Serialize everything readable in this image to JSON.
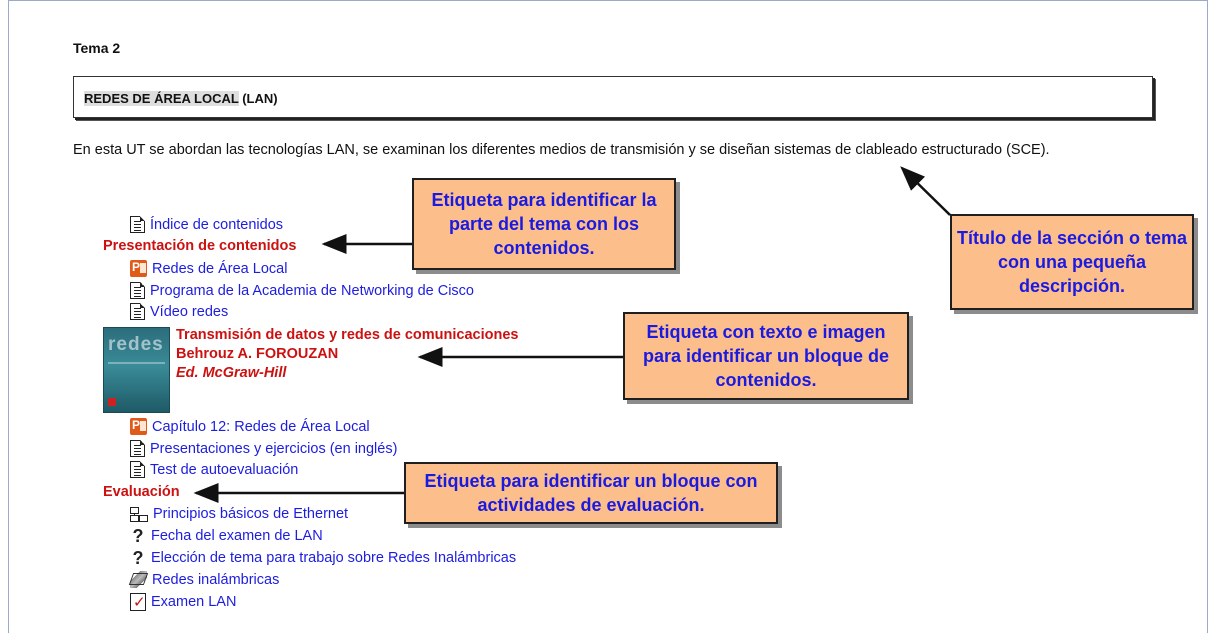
{
  "section": {
    "label": "Tema 2",
    "title_highlight": "REDES DE ÁREA LOCAL",
    "title_rest": " (LAN)",
    "description": "En esta UT se abordan las tecnologías LAN, se examinan los diferentes medios de transmisión y se diseñan sistemas de clableado estructurado (SCE)."
  },
  "resources": {
    "indice": "Índice de contenidos",
    "presentacion_heading": "Presentación de contenidos",
    "redes_area_local": "Redes de Área Local",
    "programa_cisco": "Programa de la Academia de Networking de Cisco",
    "video_redes": "Vídeo redes",
    "book": {
      "title": "Transmisión de datos y redes de comunicaciones",
      "author": "Behrouz A. FOROUZAN",
      "publisher": "Ed. McGraw-Hill",
      "cover_text": "redes"
    },
    "capitulo12": "Capítulo 12: Redes de Área Local",
    "presentaciones": "Presentaciones y ejercicios (en inglés)",
    "test": "Test de autoevaluación",
    "evaluacion_heading": "Evaluación",
    "ethernet": "Principios básicos de Ethernet",
    "fecha_examen": "Fecha del examen de LAN",
    "eleccion_tema": "Elección de tema para trabajo sobre Redes Inalámbricas",
    "redes_inalambricas": "Redes inalámbricas",
    "examen_lan": "Examen LAN"
  },
  "callouts": {
    "contenidos": "Etiqueta para identificar la parte del tema con los contenidos.",
    "seccion": "Título de la sección o tema con una pequeña descripción.",
    "bloque": "Etiqueta con texto e imagen para identificar un bloque de contenidos.",
    "evaluacion": "Etiqueta para identificar un bloque con actividades de evaluación."
  },
  "colors": {
    "link": "#1d1de0",
    "heading_red": "#cc1111",
    "callout_bg": "#fcbf8c",
    "callout_text": "#1a1ae0"
  },
  "icons": {
    "resource": "document-icon",
    "presentation": "powerpoint-icon",
    "choice": "question-icon",
    "lesson": "forum-icon",
    "wiki": "wiki-icon",
    "quiz": "quiz-icon"
  }
}
